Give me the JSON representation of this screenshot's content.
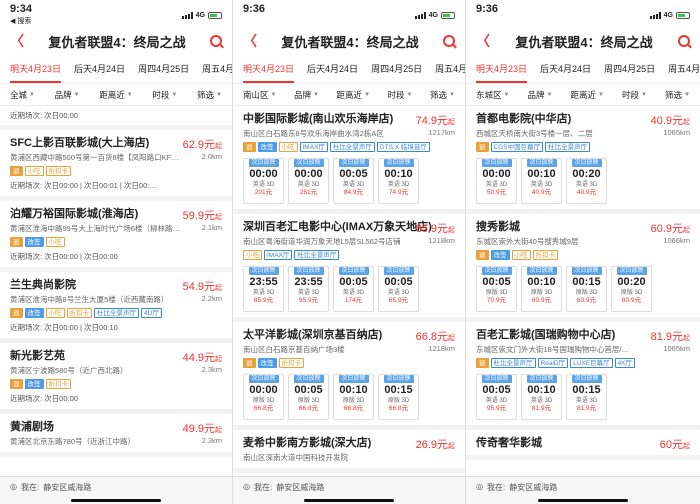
{
  "panels": [
    {
      "status": {
        "time": "9:34",
        "back_app": "◀ 搜索",
        "network": "4G"
      },
      "nav": {
        "title": "复仇者联盟4：终局之战"
      },
      "dates": [
        "明天4月23日",
        "后天4月24日",
        "周四4月25日",
        "周五4月2"
      ],
      "filters": [
        "全城",
        "品牌",
        "距离近",
        "时段",
        "筛选"
      ],
      "top_recent": "近期场次: 次日00:00",
      "cinemas": [
        {
          "name": "SFC上影百联影城(大上海店)",
          "price": "62.9元",
          "price_suffix": "起",
          "addr": "黄浦区西藏中路500号第一百货8楼【凤阳路口KF…",
          "dist": "2.0km",
          "tags": [
            {
              "t": "退",
              "c": "solid"
            },
            {
              "t": "小吃",
              "c": ""
            },
            {
              "t": "折扣卡",
              "c": ""
            }
          ],
          "recent": "近期场次: 次日00:00 | 次日00:01 | 次日00:…"
        },
        {
          "name": "泊耀万裕国际影城(淮海店)",
          "price": "59.9元",
          "price_suffix": "起",
          "addr": "黄浦区淮海中路99号大上海时代广场6楼（柳林路…",
          "dist": "2.1km",
          "tags": [
            {
              "t": "退",
              "c": "solid"
            },
            {
              "t": "改签",
              "c": "bsolid"
            },
            {
              "t": "小吃",
              "c": ""
            }
          ],
          "recent": "近期场次: 次日00:00 | 次日00:00"
        },
        {
          "name": "兰生典尚影院",
          "price": "54.9元",
          "price_suffix": "起",
          "addr": "黄浦区淮海中路8号兰生大厦5楼（近西藏南路）",
          "dist": "2.2km",
          "tags": [
            {
              "t": "退",
              "c": "solid"
            },
            {
              "t": "改签",
              "c": "bsolid"
            },
            {
              "t": "小吃",
              "c": ""
            },
            {
              "t": "折扣卡",
              "c": ""
            },
            {
              "t": "杜比全景声厅",
              "c": "blue"
            },
            {
              "t": "4D厅",
              "c": "blue"
            }
          ],
          "recent": "近期场次: 次日00:00 | 次日00:10"
        },
        {
          "name": "新光影艺苑",
          "price": "44.9元",
          "price_suffix": "起",
          "addr": "黄浦区宁波路580号（近广西北路）",
          "dist": "2.3km",
          "tags": [
            {
              "t": "退",
              "c": "solid"
            },
            {
              "t": "改签",
              "c": "bsolid"
            },
            {
              "t": "折扣卡",
              "c": ""
            }
          ],
          "recent": "近期场次: 次日00:00"
        },
        {
          "name": "黄浦剧场",
          "price": "49.9元",
          "price_suffix": "起",
          "addr": "黄浦区北京东路780号（近浙江中路）",
          "dist": "2.3km",
          "tags": [],
          "recent": ""
        }
      ],
      "bottom": {
        "label": "我在:",
        "location": "静安区威海路"
      }
    },
    {
      "status": {
        "time": "9:36",
        "back_app": "",
        "network": "4G"
      },
      "nav": {
        "title": "复仇者联盟4：终局之战"
      },
      "dates": [
        "明天4月23日",
        "后天4月24日",
        "周四4月25日",
        "周五4月2"
      ],
      "filters": [
        "南山区",
        "品牌",
        "距离近",
        "时段",
        "筛选"
      ],
      "top_recent": "",
      "cinemas": [
        {
          "name": "中影国际影城(南山欢乐海岸店)",
          "price": "74.9元",
          "price_suffix": "起",
          "addr": "南山区白石路东8号欢乐海岸曲水湾2栋A区",
          "dist": "1217km",
          "tags": [
            {
              "t": "退",
              "c": "solid"
            },
            {
              "t": "改签",
              "c": "bsolid"
            },
            {
              "t": "小吃",
              "c": ""
            },
            {
              "t": "IMAX厅",
              "c": "blue"
            },
            {
              "t": "杜比全景声厅",
              "c": "blue"
            },
            {
              "t": "DTS:X 临境音厅",
              "c": "blue"
            }
          ],
          "shows": [
            {
              "l": "次日放映",
              "t": "00:00",
              "v": "英语 3D",
              "p": "201元"
            },
            {
              "l": "次日放映",
              "t": "00:00",
              "v": "英语 3D",
              "p": "261元"
            },
            {
              "l": "次日放映",
              "t": "00:05",
              "v": "英语 3D",
              "p": "84.9元"
            },
            {
              "l": "次日放映",
              "t": "00:10",
              "v": "英语 3D",
              "p": "74.9元"
            }
          ]
        },
        {
          "name": "深圳百老汇电影中心(IMAX万象天地店)",
          "price": "65.9元",
          "price_suffix": "起",
          "addr": "南山区粤海街道华润万象天地L5层SL562号店铺",
          "dist": "1218km",
          "tags": [
            {
              "t": "小吃",
              "c": ""
            },
            {
              "t": "IMAX厅",
              "c": "blue"
            },
            {
              "t": "杜比全景声厅",
              "c": "blue"
            }
          ],
          "shows": [
            {
              "l": "次日放映",
              "t": "23:55",
              "v": "英语 3D",
              "p": "85.9元"
            },
            {
              "l": "次日放映",
              "t": "23:55",
              "v": "英语 3D",
              "p": "95.9元"
            },
            {
              "l": "次日放映",
              "t": "00:05",
              "v": "英语 3D",
              "p": "174元"
            },
            {
              "l": "次日放映",
              "t": "00:05",
              "v": "英语 3D",
              "p": "65.9元"
            }
          ]
        },
        {
          "name": "太平洋影城(深圳京基百纳店)",
          "price": "66.8元",
          "price_suffix": "起",
          "addr": "南山区白石路京基百纳广场3楼",
          "dist": "1218km",
          "tags": [
            {
              "t": "退",
              "c": "solid"
            },
            {
              "t": "改签",
              "c": "bsolid"
            },
            {
              "t": "折扣卡",
              "c": ""
            }
          ],
          "shows": [
            {
              "l": "次日放映",
              "t": "00:00",
              "v": "原版 3D",
              "p": "66.8元"
            },
            {
              "l": "次日放映",
              "t": "00:05",
              "v": "原版 3D",
              "p": "66.8元"
            },
            {
              "l": "次日放映",
              "t": "00:10",
              "v": "原版 3D",
              "p": "66.8元"
            },
            {
              "l": "次日放映",
              "t": "00:15",
              "v": "原版 3D",
              "p": "66.8元"
            }
          ]
        },
        {
          "name": "麦希中影南方影城(深大店)",
          "price": "26.9元",
          "price_suffix": "起",
          "addr": "南山区深南大道中国科技开发院",
          "dist": "",
          "tags": [],
          "shows": []
        }
      ],
      "bottom": {
        "label": "我在:",
        "location": "静安区威海路"
      }
    },
    {
      "status": {
        "time": "9:36",
        "back_app": "",
        "network": "4G"
      },
      "nav": {
        "title": "复仇者联盟4：终局之战"
      },
      "dates": [
        "明天4月23日",
        "后天4月24日",
        "周四4月25日",
        "周五4月2"
      ],
      "filters": [
        "东城区",
        "品牌",
        "距离近",
        "时段",
        "筛选"
      ],
      "top_recent": "",
      "cinemas": [
        {
          "name": "首都电影院(中华店)",
          "price": "40.9元",
          "price_suffix": "起",
          "addr": "西城区天桥南大街3号楼一层、二层",
          "dist": "1065km",
          "tags": [
            {
              "t": "退",
              "c": "solid"
            },
            {
              "t": "CGS中国巨幕厅",
              "c": "blue"
            },
            {
              "t": "杜比全景声厅",
              "c": "blue"
            }
          ],
          "shows": [
            {
              "l": "次日放映",
              "t": "00:00",
              "v": "英语 3D",
              "p": "50.9元"
            },
            {
              "l": "次日放映",
              "t": "00:10",
              "v": "英语 3D",
              "p": "40.9元"
            },
            {
              "l": "次日放映",
              "t": "00:20",
              "v": "英语 3D",
              "p": "40.9元"
            }
          ]
        },
        {
          "name": "搜秀影城",
          "price": "60.9元",
          "price_suffix": "起",
          "addr": "东城区崇外大街40号搜秀城9层",
          "dist": "1066km",
          "tags": [
            {
              "t": "退",
              "c": "solid"
            },
            {
              "t": "改签",
              "c": "bsolid"
            },
            {
              "t": "小吃",
              "c": ""
            },
            {
              "t": "折扣卡",
              "c": ""
            }
          ],
          "shows": [
            {
              "l": "次日放映",
              "t": "00:05",
              "v": "原版 3D",
              "p": "70.9元"
            },
            {
              "l": "次日放映",
              "t": "00:10",
              "v": "原版 3D",
              "p": "60.9元"
            },
            {
              "l": "次日放映",
              "t": "00:15",
              "v": "原版 3D",
              "p": "60.9元"
            },
            {
              "l": "次日放映",
              "t": "00:20",
              "v": "原版 3D",
              "p": "80.9元"
            }
          ]
        },
        {
          "name": "百老汇影城(国瑞购物中心店)",
          "price": "81.9元",
          "price_suffix": "起",
          "addr": "东城区崇文门外大街18号国瑞购物中心首层/…",
          "dist": "1065km",
          "tags": [
            {
              "t": "退",
              "c": "solid"
            },
            {
              "t": "杜比全景声厅",
              "c": "blue"
            },
            {
              "t": "RealD厅",
              "c": "blue"
            },
            {
              "t": "LUXE巨幕厅",
              "c": "blue"
            },
            {
              "t": "4K厅",
              "c": "blue"
            }
          ],
          "shows": [
            {
              "l": "次日放映",
              "t": "00:05",
              "v": "英语 3D",
              "p": "95.9元"
            },
            {
              "l": "次日放映",
              "t": "00:10",
              "v": "英语 3D",
              "p": "81.9元"
            },
            {
              "l": "次日放映",
              "t": "00:15",
              "v": "英语 3D",
              "p": "81.9元"
            }
          ]
        },
        {
          "name": "传奇奢华影城",
          "price": "60元",
          "price_suffix": "起",
          "addr": "",
          "dist": "",
          "tags": [],
          "shows": []
        }
      ],
      "bottom": {
        "label": "我在:",
        "location": "静安区威海路"
      }
    }
  ]
}
